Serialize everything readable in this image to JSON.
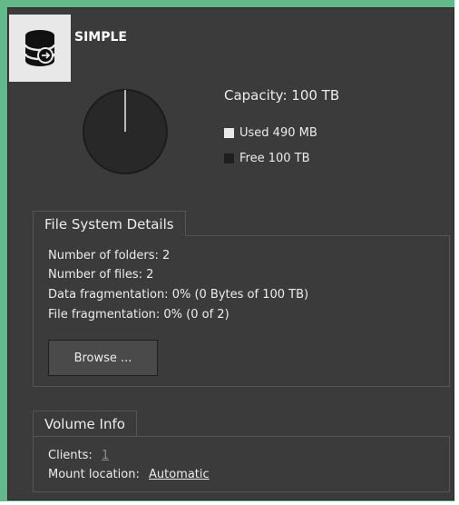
{
  "volume": {
    "name": "SIMPLE",
    "icon": "database-icon"
  },
  "usage": {
    "capacity_label": "Capacity: 100 TB",
    "used_label": "Used 490 MB",
    "free_label": "Free 100 TB",
    "used_fraction": 4.9e-06,
    "colors": {
      "used": "#e8e8e8",
      "free": "#282828"
    }
  },
  "fs_details": {
    "title": "File System Details",
    "folders": "Number of folders: 2",
    "files": "Number of files: 2",
    "data_frag": "Data fragmentation: 0% (0 Bytes of 100 TB)",
    "file_frag": "File fragmentation: 0% (0 of 2)",
    "browse_label": "Browse ..."
  },
  "volume_info": {
    "title": "Volume Info",
    "clients_label": "Clients:",
    "clients_value": "1",
    "mount_label": "Mount location:",
    "mount_value": "Automatic"
  },
  "colors": {
    "accent_border": "#64b98a",
    "panel_bg": "#3b3b3b"
  }
}
